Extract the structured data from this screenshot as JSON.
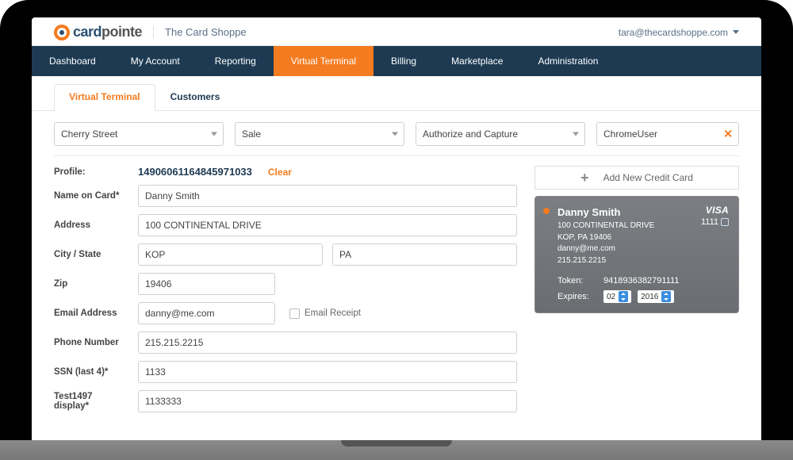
{
  "header": {
    "logo_text_1": "card",
    "logo_text_2": "pointe",
    "subtitle": "The Card Shoppe",
    "user_email": "tara@thecardshoppe.com"
  },
  "nav": {
    "items": [
      "Dashboard",
      "My Account",
      "Reporting",
      "Virtual Terminal",
      "Billing",
      "Marketplace",
      "Administration"
    ],
    "active_index": 3
  },
  "tabs": {
    "items": [
      "Virtual Terminal",
      "Customers"
    ],
    "active_index": 0
  },
  "filters": {
    "location": "Cherry Street",
    "txn_type": "Sale",
    "action": "Authorize and Capture",
    "user": "ChromeUser"
  },
  "form": {
    "profile_label": "Profile:",
    "profile_value": "14906061164845971033",
    "clear_label": "Clear",
    "name_label": "Name on Card*",
    "name_value": "Danny Smith",
    "address_label": "Address",
    "address_value": "100 CONTINENTAL DRIVE",
    "citystate_label": "City / State",
    "city_value": "KOP",
    "state_value": "PA",
    "zip_label": "Zip",
    "zip_value": "19406",
    "email_label": "Email Address",
    "email_value": "danny@me.com",
    "email_receipt_label": "Email Receipt",
    "phone_label": "Phone Number",
    "phone_value": "215.215.2215",
    "ssn_label": "SSN (last 4)*",
    "ssn_value": "1133",
    "test_label": "Test1497 display*",
    "test_value": "1133333"
  },
  "card_panel": {
    "add_label": "Add New Credit Card",
    "name": "Danny Smith",
    "line1": "100 CONTINENTAL DRIVE",
    "line2": "KOP, PA 19406",
    "line3": "danny@me.com",
    "line4": "215.215.2215",
    "brand": "VISA",
    "last4": "1111",
    "token_label": "Token:",
    "token_value": "9418936382791111",
    "expires_label": "Expires:",
    "exp_month": "02",
    "exp_year": "2016"
  }
}
